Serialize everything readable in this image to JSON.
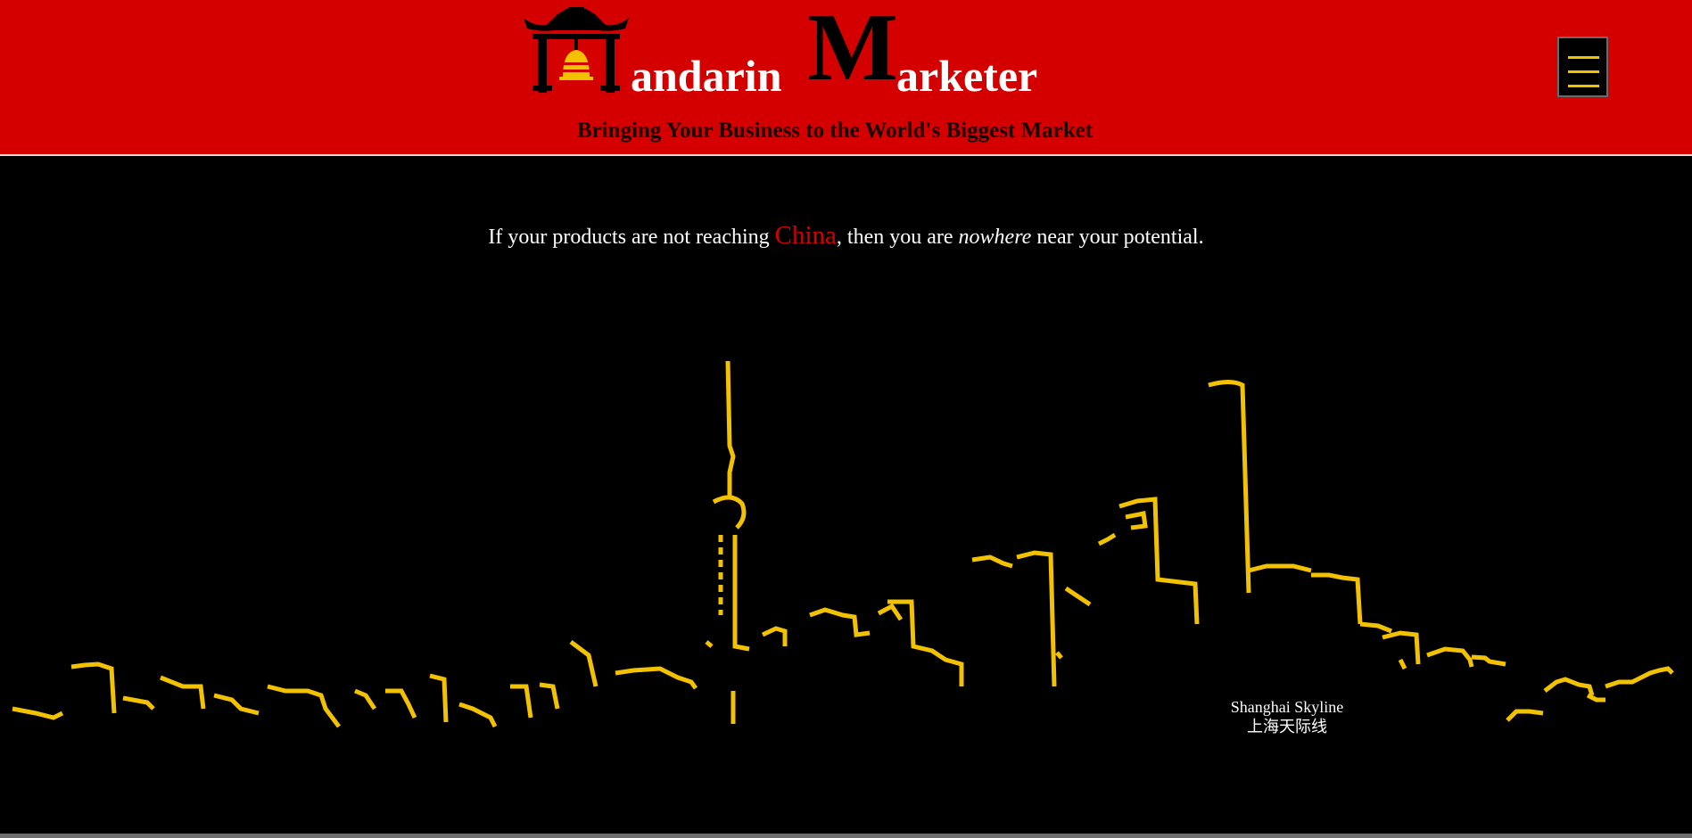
{
  "brand": {
    "name_small_1": "andarin",
    "name_big": "M",
    "name_small_2": "arketer",
    "tagline": "Bringing Your Business to the World's Biggest Market",
    "logo_icon": "pagoda-bell-icon"
  },
  "header": {
    "menu_icon": "hamburger-menu-icon"
  },
  "hero": {
    "headline_part1": "If your products are not reaching ",
    "headline_highlight": "China",
    "headline_part2": ", then you are ",
    "headline_emphasis": "nowhere",
    "headline_part3": " near your potential."
  },
  "skyline": {
    "caption_en": "Shanghai Skyline",
    "caption_zh": "上海天际线"
  },
  "colors": {
    "header_bg": "#d40000",
    "accent_yellow": "#f2c200",
    "page_bg": "#000000",
    "highlight_red": "#d40000"
  }
}
